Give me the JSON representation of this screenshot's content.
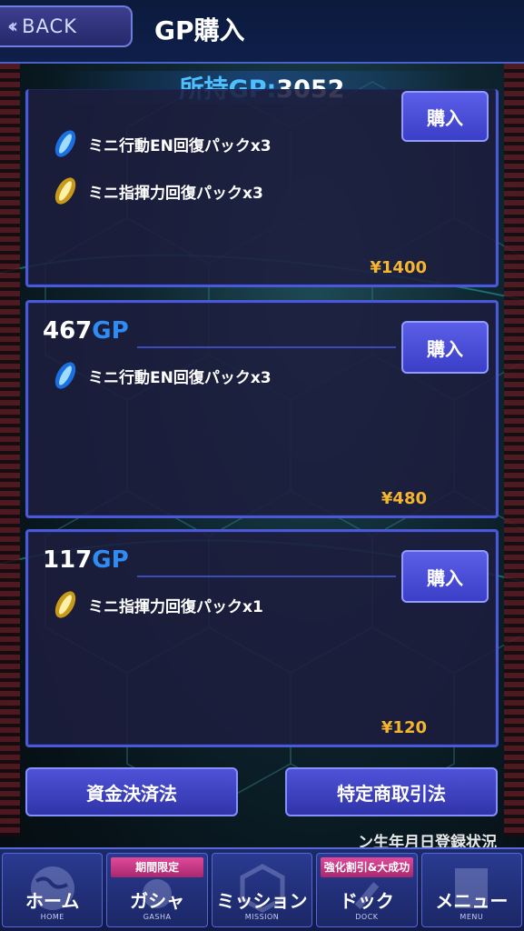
{
  "header": {
    "back_label": "BACK",
    "title": "GP購入"
  },
  "gp_balance": {
    "label": "所持GP:",
    "value": "3052"
  },
  "packs": [
    {
      "gp": "",
      "unit": "",
      "buy_label": "購入",
      "items": [
        {
          "icon": "blue-en-capsule-icon",
          "label": "ミニ行動EN回復パックx3"
        },
        {
          "icon": "gold-command-capsule-icon",
          "label": "ミニ指揮力回復パックx3"
        }
      ],
      "price": "¥1400"
    },
    {
      "gp": "467",
      "unit": "GP",
      "buy_label": "購入",
      "items": [
        {
          "icon": "blue-en-capsule-icon",
          "label": "ミニ行動EN回復パックx3"
        }
      ],
      "price": "¥480"
    },
    {
      "gp": "117",
      "unit": "GP",
      "buy_label": "購入",
      "items": [
        {
          "icon": "gold-command-capsule-icon",
          "label": "ミニ指揮力回復パックx1"
        }
      ],
      "price": "¥120"
    }
  ],
  "legal": {
    "funds_settlement": "資金決済法",
    "commercial_transactions": "特定商取引法"
  },
  "login_status_text": "ン生年月日登録状況",
  "nav": [
    {
      "label": "ホーム",
      "sub": "HOME",
      "badge": "",
      "icon": "globe-icon"
    },
    {
      "label": "ガシャ",
      "sub": "GASHA",
      "badge": "期間限定",
      "icon": "capsule-machine-icon"
    },
    {
      "label": "ミッション",
      "sub": "MISSION",
      "badge": "",
      "icon": "hexagon-icon"
    },
    {
      "label": "ドック",
      "sub": "DOCK",
      "badge": "強化割引&大成功",
      "icon": "wrench-icon"
    },
    {
      "label": "メニュー",
      "sub": "MENU",
      "badge": "",
      "icon": "menu-list-icon"
    }
  ],
  "colors": {
    "accent_blue": "#2f8cf5",
    "price_gold": "#f5b52e",
    "button_purple": "#4b4ee0",
    "badge_pink": "#d63d8c"
  }
}
